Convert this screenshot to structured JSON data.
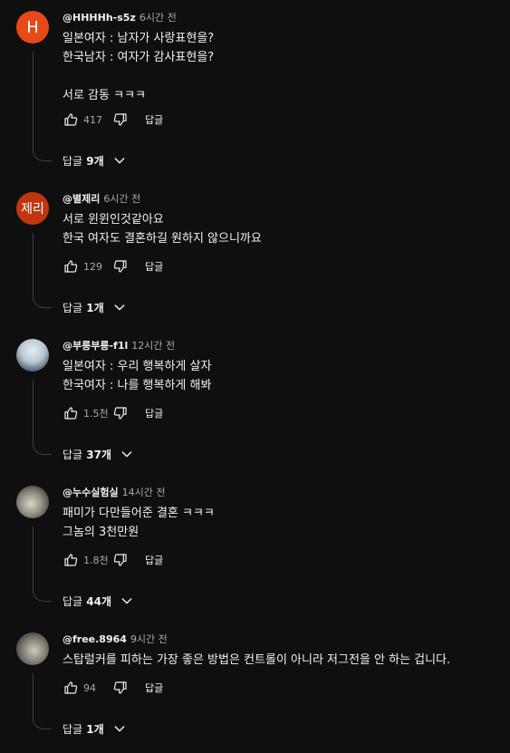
{
  "comments": [
    {
      "author": "@HHHHh-s5z",
      "time": "6시간 전",
      "avatar_text": "H",
      "lines": [
        "일본여자 : 남자가 사랑표현을?",
        "한국남자 : 여자가 감사표현을?",
        "",
        "서로 감동 ㅋㅋㅋ"
      ],
      "likes": "417",
      "reply_label": "답글",
      "replies_word": "답글",
      "replies_count": "9개"
    },
    {
      "author": "@별제리",
      "time": "6시간 전",
      "avatar_text": "제리",
      "lines": [
        "서로 윈윈인것같아요",
        "한국 여자도 결혼하길 원하지 않으니까요"
      ],
      "likes": "129",
      "reply_label": "답글",
      "replies_word": "답글",
      "replies_count": "1개"
    },
    {
      "author": "@부릉부릉-f1l",
      "time": "12시간 전",
      "avatar_text": "",
      "lines": [
        "일본여자 : 우리 행복하게 살자",
        "한국여자 : 나를 행복하게 해봐"
      ],
      "likes": "1.5천",
      "reply_label": "답글",
      "replies_word": "답글",
      "replies_count": "37개"
    },
    {
      "author": "@누수실험실",
      "time": "14시간 전",
      "avatar_text": "",
      "lines": [
        "패미가 다만들어준 결혼 ㅋㅋㅋ",
        "그놈의 3천만원"
      ],
      "likes": "1.8천",
      "reply_label": "답글",
      "replies_word": "답글",
      "replies_count": "44개"
    },
    {
      "author": "@free.8964",
      "time": "9시간 전",
      "avatar_text": "",
      "lines": [
        "스탑럴커를 피하는 가장 좋은 방법은 컨트롤이 아니라 저그전을 안 하는 겁니다."
      ],
      "likes": "94",
      "reply_label": "답글",
      "replies_word": "답글",
      "replies_count": "1개"
    }
  ],
  "icons": {
    "like": "thumb-up-icon",
    "dislike": "thumb-down-icon",
    "expand": "chevron-down-icon"
  },
  "colors": {
    "background": "#0f0f0f",
    "text": "#f1f1f1",
    "secondary_text": "#aaaaaa",
    "avatar_h": "#e64a19",
    "avatar_jeri": "#c1360f"
  }
}
